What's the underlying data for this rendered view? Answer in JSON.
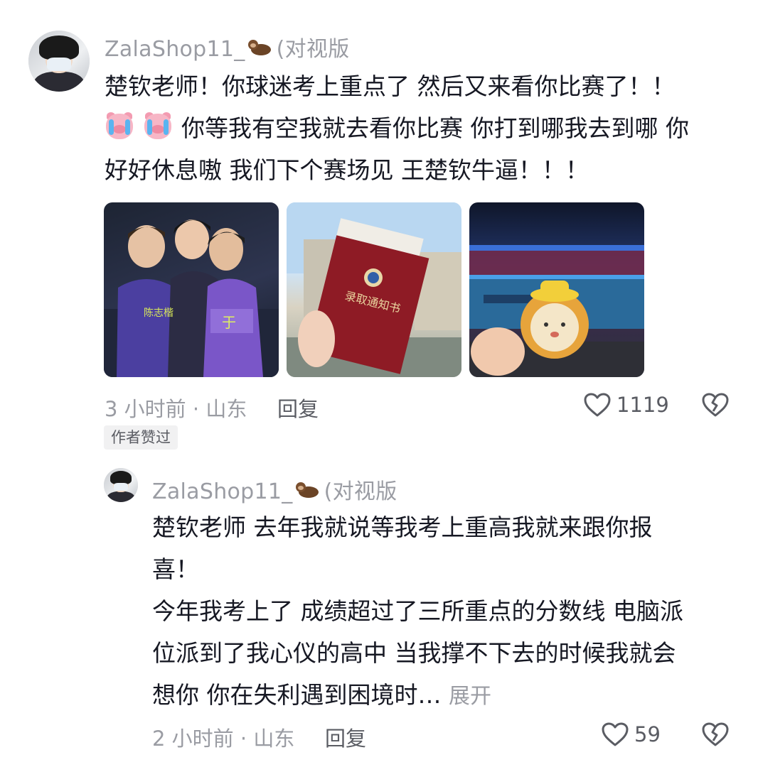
{
  "comment": {
    "username": "ZalaShop11_",
    "username_suffix": "(对视版",
    "text_lines": [
      "楚钦老师！你球迷考上重点了 然后又来看你比赛了！！",
      "你等我有空我就去看你比赛 你打到哪我去到哪 你",
      "好好休息嗷 我们下个赛场见 王楚钦牛逼！！！"
    ],
    "photos": [
      {
        "name": "photo-players"
      },
      {
        "name": "photo-admission-letter",
        "caption": "录取通知书"
      },
      {
        "name": "photo-stadium-plush"
      }
    ],
    "time_location": "3 小时前 · 山东",
    "reply_label": "回复",
    "like_count": "1119",
    "author_badge": "作者赞过"
  },
  "reply": {
    "username": "ZalaShop11_",
    "username_suffix": "(对视版",
    "text_lines": [
      "楚钦老师 去年我就说等我考上重高我就来跟你报",
      "喜！",
      "今年我考上了 成绩超过了三所重点的分数线 电脑派",
      "位派到了我心仪的高中 当我撑不下去的时候我就会",
      "想你 你在失利遇到困境时…"
    ],
    "expand_label": "展开",
    "time_location": "2 小时前 · 山东",
    "reply_label": "回复",
    "like_count": "59"
  }
}
